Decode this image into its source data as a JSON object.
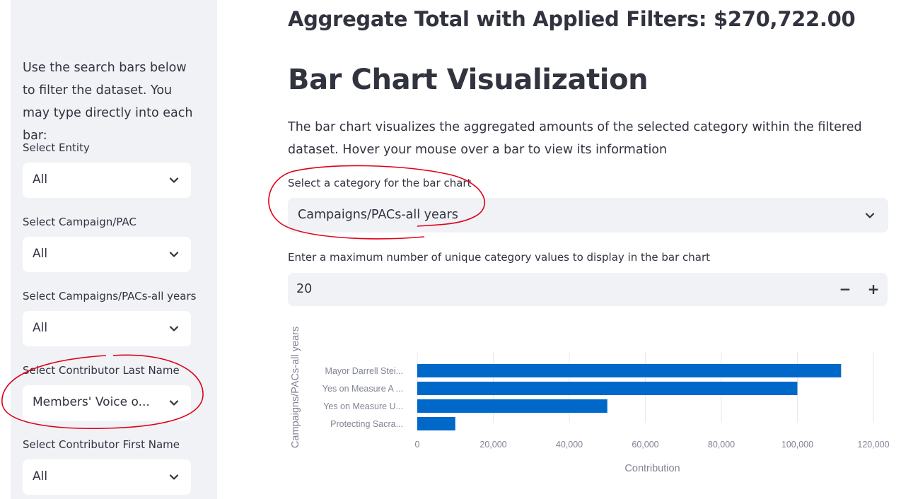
{
  "sidebar": {
    "intro": "Use the search bars below to filter the dataset. You may type directly into each bar:",
    "filters": [
      {
        "label": "Select Entity",
        "value": "All"
      },
      {
        "label": "Select Campaign/PAC",
        "value": "All"
      },
      {
        "label": "Select Campaigns/PACs-all years",
        "value": "All"
      },
      {
        "label": "Select Contributor Last Name",
        "value": "Members' Voice o..."
      },
      {
        "label": "Select Contributor First Name",
        "value": "All"
      }
    ]
  },
  "main": {
    "aggregate_text": "Aggregate Total with Applied Filters: $270,722.00",
    "section_title": "Bar Chart Visualization",
    "description": "The bar chart visualizes the aggregated amounts of the selected category within the filtered dataset. Hover your mouse over a bar to view its information",
    "category_select": {
      "label": "Select a category for the bar chart",
      "value": "Campaigns/PACs-all years"
    },
    "max_input": {
      "label": "Enter a maximum number of unique category values to display in the bar chart",
      "value": "20",
      "minus": "−",
      "plus": "+"
    }
  },
  "colors": {
    "bar": "#0068c9",
    "annotation": "#e0001b",
    "sidebar_bg": "#f0f2f6"
  },
  "chart_data": {
    "type": "bar",
    "orientation": "horizontal",
    "categories": [
      "Mayor Darrell Stei...",
      "Yes on Measure A ...",
      "Yes on Measure U...",
      "Protecting Sacra..."
    ],
    "values": [
      111500,
      100000,
      50000,
      10000
    ],
    "xlabel": "Contribution",
    "ylabel": "Campaigns/PACs-all years",
    "xlim": [
      0,
      120000
    ],
    "xticks": [
      0,
      20000,
      40000,
      60000,
      80000,
      100000,
      120000
    ],
    "xtick_labels": [
      "0",
      "20,000",
      "40,000",
      "60,000",
      "80,000",
      "100,000",
      "120,000"
    ],
    "grid": true
  }
}
